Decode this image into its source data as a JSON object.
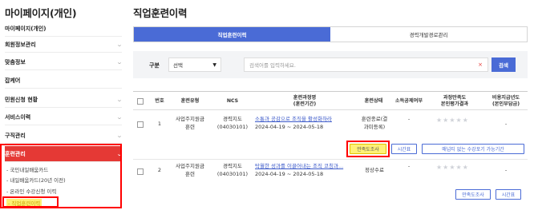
{
  "sidebar": {
    "title": "마이페이지(개인)",
    "items": [
      {
        "label": "마이페이지(개인)",
        "has_chevron": false
      },
      {
        "label": "회원정보관리",
        "has_chevron": true
      },
      {
        "label": "맞춤정보",
        "has_chevron": true
      },
      {
        "label": "잡케어",
        "has_chevron": false
      },
      {
        "label": "민원신청 현황",
        "has_chevron": true
      },
      {
        "label": "서비스이력",
        "has_chevron": true
      },
      {
        "label": "구직관리",
        "has_chevron": true
      },
      {
        "label": "훈련관리",
        "has_chevron": true,
        "active": true
      }
    ],
    "subitems": [
      {
        "label": "- 국민내일배움카드"
      },
      {
        "label": "- 내일배움카드(20년 이전)"
      },
      {
        "label": "- 온라인 수강신청 이력"
      },
      {
        "label": "- 직업훈련이력",
        "current": true
      }
    ],
    "chevron_glyph": "⌄"
  },
  "main": {
    "title": "직업훈련이력",
    "tabs": [
      {
        "label": "직업훈련이력",
        "active": true
      },
      {
        "label": "경력개발경로관리",
        "active": false
      }
    ],
    "search": {
      "label": "구분",
      "select_value": "선택",
      "placeholder": "검색어를 입력하세요.",
      "clear_glyph": "×",
      "button_label": "검색"
    },
    "table": {
      "headers": {
        "no": "번호",
        "type": "훈련유형",
        "ncs": "NCS",
        "course": "훈련과정명\n(훈련기간)",
        "status": "훈련상태",
        "income": "소득공제여부",
        "satisfaction": "과정만족도\n본인평가결과",
        "cost": "비용지급년도\n(본인부담금)"
      },
      "rows": [
        {
          "no": "1",
          "type": "사업주지원금\n훈련",
          "ncs": "경력지도\n(04030101)",
          "course_name": "소통과 공감으로 조직을 활성화하라",
          "period": "2024-04-19 ~ 2024-05-18",
          "status": "훈련종료(결\n과미등록)",
          "income": "-",
          "stars": "★★★★★",
          "cost": "-",
          "buttons": [
            "만족도조사",
            "시간표",
            "매넘티 없는 수강포기 가능기간"
          ]
        },
        {
          "no": "2",
          "type": "사업주지원금\n훈련",
          "ncs": "경력지도\n(04030101)",
          "course_name": "탁월한 성과를 이끌어내는 조직 코칭과...",
          "period": "2024-04-19 ~ 2024-05-18",
          "status": "정상수료",
          "income": "-",
          "stars": "★★★★★",
          "cost": "-",
          "buttons": [
            "만족도조사",
            "시간표"
          ]
        }
      ]
    }
  },
  "colors": {
    "accent": "#4a6bd6",
    "sidebar_active": "#e53935",
    "annotation_red": "#ff0000",
    "highlight_yellow": "#fff176"
  }
}
